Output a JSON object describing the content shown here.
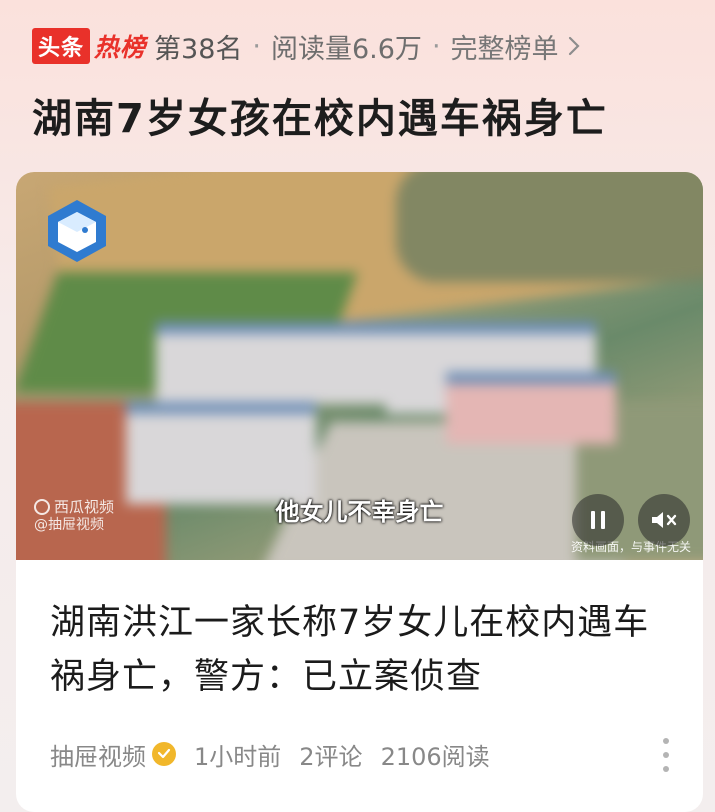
{
  "header": {
    "logo_part1": "头条",
    "logo_part2": "热榜",
    "rank": "第38名",
    "separator": "·",
    "read_count": "阅读量6.6万",
    "full_list": "完整榜单"
  },
  "topic_title": "湖南7岁女孩在校内遇车祸身亡",
  "video": {
    "subtitle": "他女儿不幸身亡",
    "watermark_line1": "西瓜视频",
    "watermark_line2": "@抽屉视频",
    "disclaimer": "资料画面，与事件无关",
    "pause_icon": "pause-icon",
    "mute_icon": "mute-icon"
  },
  "article": {
    "title": "湖南洪江一家长称7岁女儿在校内遇车祸身亡，警方：已立案侦查",
    "source": "抽屉视频",
    "time": "1小时前",
    "comments": "2评论",
    "reads": "2106阅读"
  },
  "colors": {
    "brand_red": "#e9312a",
    "verify_badge": "#f1b72b"
  }
}
